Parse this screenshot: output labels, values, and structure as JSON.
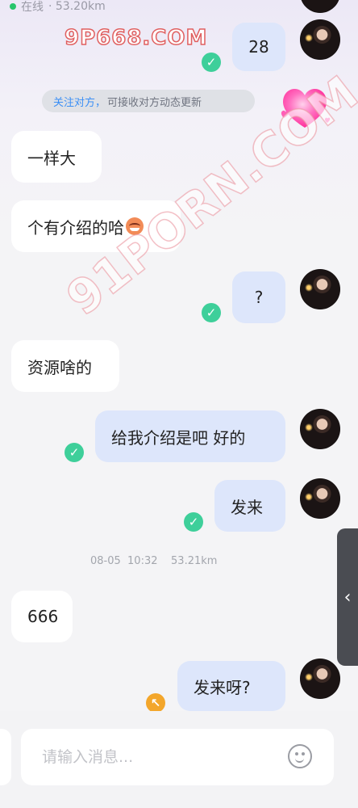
{
  "header": {
    "status": "在线",
    "distance": "· 53.20km"
  },
  "watermarks": [
    "9P668.COM",
    "91PORN.COM"
  ],
  "notice": {
    "link": "关注对方，",
    "text": "可接收对方动态更新"
  },
  "messages": [
    {
      "dir": "out",
      "text": "28",
      "status": "read"
    },
    {
      "dir": "in",
      "text": "一样大"
    },
    {
      "dir": "in",
      "text": "个有介绍的哈",
      "emoji": "grinning-face"
    },
    {
      "dir": "out",
      "text": "?",
      "status": "read"
    },
    {
      "dir": "in",
      "text": "资源啥的"
    },
    {
      "dir": "out",
      "text": "给我介绍是吧 好的",
      "status": "read"
    },
    {
      "dir": "out",
      "text": "发来",
      "status": "read"
    },
    {
      "dir": "in",
      "text": "666"
    },
    {
      "dir": "out",
      "text": "发来呀?",
      "status": "sending"
    }
  ],
  "timestamp": "08-05  10:32    53.21km",
  "side_tab": {
    "icon": "chevron-left-icon",
    "glyph": "‹"
  },
  "input": {
    "placeholder": "请输入消息..."
  },
  "icons": {
    "read": "✓",
    "sending": "↖"
  },
  "colors": {
    "accent": "#3b8ff5",
    "read": "#3ecf9a",
    "sending": "#f3a62b",
    "bubble_out": "#dde6fb",
    "bubble_in": "#ffffff"
  }
}
